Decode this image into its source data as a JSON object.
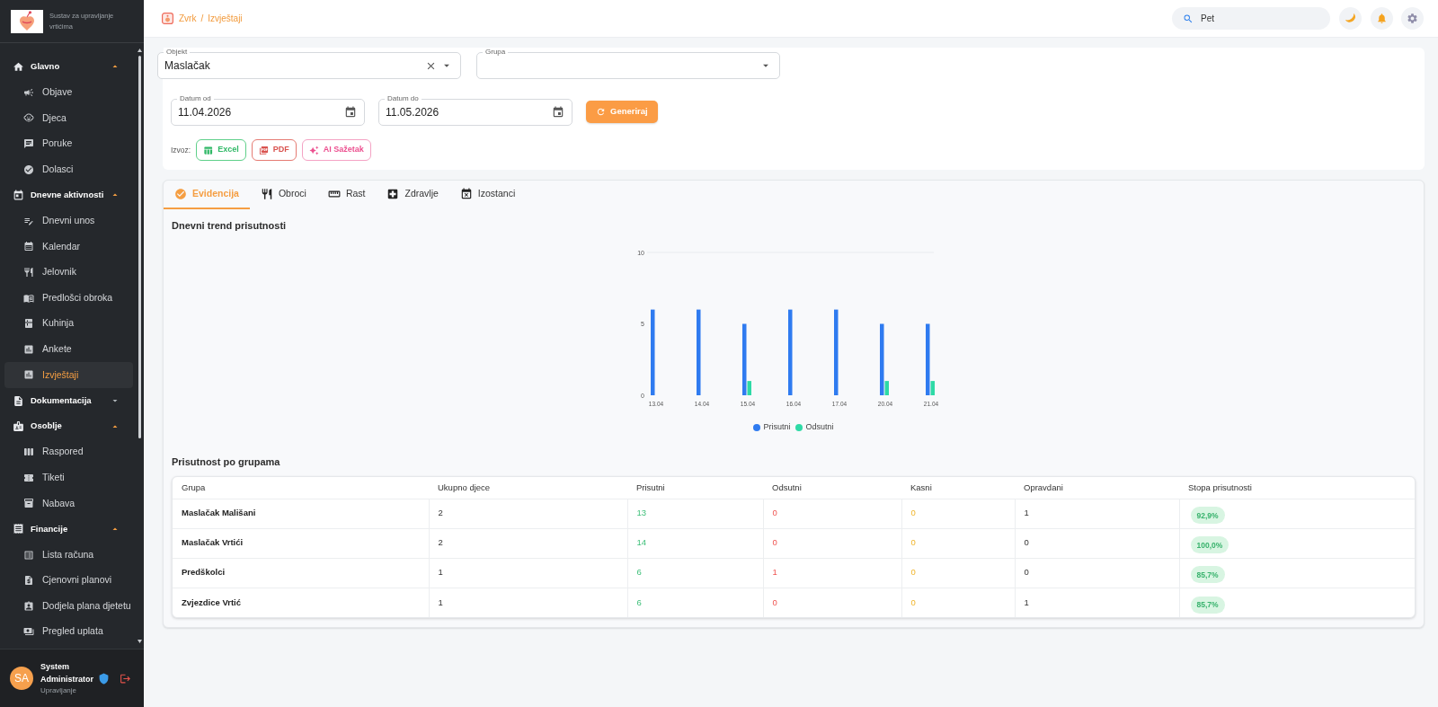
{
  "sidebar": {
    "app_subtitle": "Sustav za upravljanje vrtićima",
    "sections": [
      {
        "label": "Glavno",
        "expanded": true,
        "items": [
          {
            "label": "Objave",
            "selected": false
          },
          {
            "label": "Djeca",
            "selected": false
          },
          {
            "label": "Poruke",
            "selected": false
          },
          {
            "label": "Dolasci",
            "selected": false
          }
        ]
      },
      {
        "label": "Dnevne aktivnosti",
        "expanded": true,
        "items": [
          {
            "label": "Dnevni unos",
            "selected": false
          },
          {
            "label": "Kalendar",
            "selected": false
          },
          {
            "label": "Jelovnik",
            "selected": false
          },
          {
            "label": "Predlošci obroka",
            "selected": false
          },
          {
            "label": "Kuhinja",
            "selected": false
          },
          {
            "label": "Ankete",
            "selected": false
          },
          {
            "label": "Izvještaji",
            "selected": true
          }
        ]
      },
      {
        "label": "Dokumentacija",
        "expanded": false
      },
      {
        "label": "Osoblje",
        "expanded": true,
        "items": [
          {
            "label": "Raspored",
            "selected": false
          },
          {
            "label": "Tiketi",
            "selected": false
          },
          {
            "label": "Nabava",
            "selected": false
          }
        ]
      },
      {
        "label": "Financije",
        "expanded": true,
        "items": [
          {
            "label": "Lista računa",
            "selected": false
          },
          {
            "label": "Cjenovni planovi",
            "selected": false
          },
          {
            "label": "Dodjela plana djetetu",
            "selected": false
          },
          {
            "label": "Pregled uplata",
            "selected": false
          }
        ]
      }
    ],
    "user": {
      "initials": "SA",
      "name": "System Administrator",
      "role": "Upravljanje"
    }
  },
  "topbar": {
    "breadcrumb": {
      "items": [
        "Zvrk",
        "Izvještaji"
      ],
      "separator": "/"
    },
    "search": {
      "value": "Pet"
    }
  },
  "filters": {
    "objekt": {
      "label": "Objekt",
      "value": "Maslačak"
    },
    "grupa": {
      "label": "Grupa"
    },
    "date_from": {
      "label": "Datum od",
      "value": "11.04.2026"
    },
    "date_to": {
      "label": "Datum do",
      "value": "11.05.2026"
    },
    "generate_button": "Generiraj",
    "export": {
      "label": "Izvoz:",
      "buttons": [
        {
          "kind": "excel",
          "label": "Excel"
        },
        {
          "kind": "pdf",
          "label": "PDF"
        },
        {
          "kind": "ai",
          "label": "AI Sažetak"
        }
      ]
    }
  },
  "tabs": [
    {
      "label": "Evidencija",
      "selected": true
    },
    {
      "label": "Obroci",
      "selected": false
    },
    {
      "label": "Rast",
      "selected": false
    },
    {
      "label": "Zdravlje",
      "selected": false
    },
    {
      "label": "Izostanci",
      "selected": false
    }
  ],
  "trend": {
    "title": "Dnevni trend prisutnosti",
    "chart_data": {
      "type": "bar",
      "categories": [
        "13.04",
        "14.04",
        "15.04",
        "16.04",
        "17.04",
        "20.04",
        "21.04"
      ],
      "series": [
        {
          "name": "Prisutni",
          "color": "#2f7bf0",
          "values": [
            6,
            6,
            5,
            6,
            6,
            5,
            5
          ]
        },
        {
          "name": "Odsutni",
          "color": "#2edaa6",
          "values": [
            0,
            0,
            1,
            0,
            0,
            1,
            1
          ]
        }
      ],
      "ylim": [
        0,
        10
      ],
      "yticks": [
        0,
        5,
        10
      ]
    }
  },
  "groups_table": {
    "title": "Prisutnost po grupama",
    "columns": [
      {
        "label": "Grupa",
        "kind": "name"
      },
      {
        "label": "Ukupno djece",
        "kind": "count"
      },
      {
        "label": "Prisutni",
        "kind": "present"
      },
      {
        "label": "Odsutni",
        "kind": "absent"
      },
      {
        "label": "Kasni",
        "kind": "late"
      },
      {
        "label": "Opravdani",
        "kind": "count"
      },
      {
        "label": "Stopa prisutnosti",
        "kind": "rate"
      }
    ],
    "rows": [
      [
        "Maslačak Mališani",
        "2",
        "13",
        "0",
        "0",
        "1",
        "92,9%"
      ],
      [
        "Maslačak Vrtići",
        "2",
        "14",
        "0",
        "0",
        "0",
        "100,0%"
      ],
      [
        "Predškolci",
        "1",
        "6",
        "1",
        "0",
        "0",
        "85,7%"
      ],
      [
        "Zvjezdice Vrtić",
        "1",
        "6",
        "0",
        "0",
        "1",
        "85,7%"
      ]
    ]
  }
}
